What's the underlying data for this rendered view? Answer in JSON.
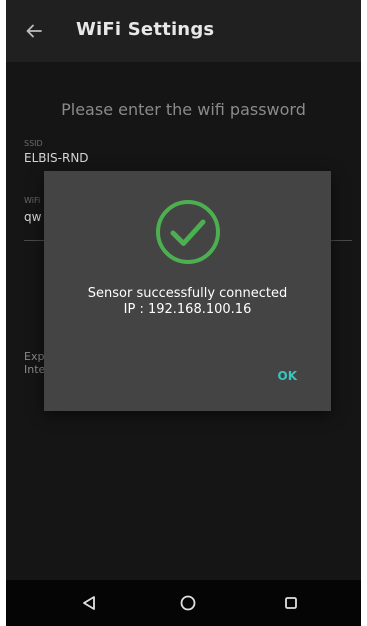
{
  "toolbar": {
    "title": "WiFi Settings",
    "back_icon": "arrow-back-icon"
  },
  "form": {
    "prompt": "Please enter the wifi password",
    "ssid_label": "SSID",
    "ssid_value": "ELBIS-RND",
    "password_label": "WiFi",
    "password_value": "qw",
    "help_text": "Exp\nInte"
  },
  "dialog": {
    "icon": "check-circle-icon",
    "message_line1": "Sensor successfully connected",
    "message_line2": "IP : 192.168.100.16",
    "ok_label": "OK"
  },
  "navbar": {
    "back_icon": "nav-back-icon",
    "home_icon": "nav-home-icon",
    "recents_icon": "nav-recents-icon"
  },
  "colors": {
    "accent": "#35c7c0",
    "success": "#4caf50",
    "dialog_bg": "#444444",
    "toolbar_bg": "#202020"
  }
}
